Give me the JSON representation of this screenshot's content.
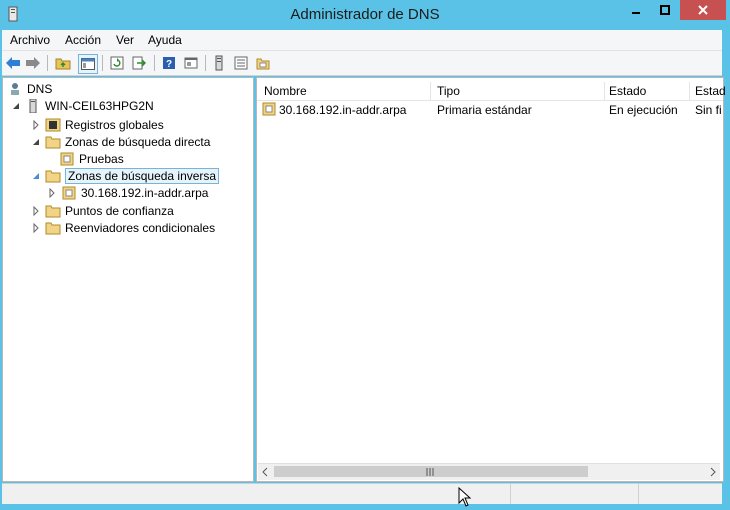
{
  "window": {
    "title": "Administrador de DNS"
  },
  "menu": [
    "Archivo",
    "Acción",
    "Ver",
    "Ayuda"
  ],
  "tree": {
    "root": "DNS",
    "server": "WIN-CEIL63HPG2N",
    "global_logs": "Registros globales",
    "forward_zones": "Zonas de búsqueda directa",
    "forward_zone_child": "Pruebas",
    "reverse_zones": "Zonas de búsqueda inversa",
    "reverse_zone_child": "30.168.192.in-addr.arpa",
    "trust_points": "Puntos de confianza",
    "conditional_forwarders": "Reenviadores condicionales"
  },
  "list": {
    "columns": [
      "Nombre",
      "Tipo",
      "Estado",
      "Estad"
    ],
    "rows": [
      {
        "name": "30.168.192.in-addr.arpa",
        "type": "Primaria estándar",
        "status": "En ejecución",
        "extra": "Sin fi"
      }
    ]
  },
  "colors": {
    "titlebar": "#5bc2e7",
    "close": "#c75050",
    "selection": "#e5f3fb",
    "selection_border": "#7ab3da"
  },
  "icons": [
    "back-icon",
    "forward-icon",
    "folder-up-icon",
    "show-tree-icon",
    "refresh-icon",
    "export-icon",
    "help-icon",
    "properties-icon",
    "server-icon",
    "list-icon",
    "zone-icon"
  ]
}
